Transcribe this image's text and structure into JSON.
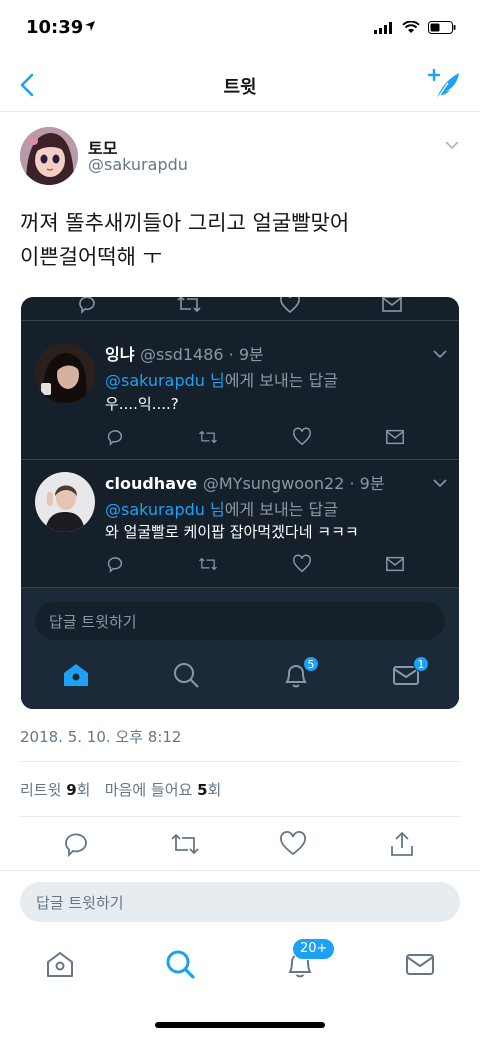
{
  "status_bar": {
    "time": "10:39"
  },
  "nav": {
    "title": "트윗"
  },
  "tweet": {
    "author_name": "토모",
    "author_handle": "@sakurapdu",
    "text_line1": "꺼져 똘추새끼들아 그리고 얼굴빨맞어",
    "text_line2": "이쁜걸어떡해 ㅜ",
    "timestamp": "2018. 5. 10. 오후 8:12",
    "retweet_label": "리트윗",
    "retweet_count": "9",
    "retweet_unit": "회",
    "like_label": "마음에 들어요",
    "like_count": "5",
    "like_unit": "회"
  },
  "embed": {
    "replies": [
      {
        "name": "잉냐",
        "handle": "@ssd1486 · 9분",
        "reply_to_mention": "@sakurapdu 님",
        "reply_to_suffix": "에게 보내는 답글",
        "text": "우....익....?"
      },
      {
        "name": "cloudhave",
        "handle": "@MYsungwoon22 · 9분",
        "reply_to_mention": "@sakurapdu 님",
        "reply_to_suffix": "에게 보내는 답글",
        "text": "와 얼굴빨로 케이팝 잡아먹겠다네 ㅋㅋㅋ"
      }
    ],
    "input_placeholder": "답글 트윗하기",
    "notifications_badge": "5",
    "messages_badge": "1"
  },
  "reply_bar": {
    "placeholder": "답글 트윗하기"
  },
  "tabbar": {
    "notifications_badge": "20+"
  },
  "colors": {
    "accent": "#1da1f2",
    "dark_bg": "#15202b",
    "muted": "#657786"
  }
}
